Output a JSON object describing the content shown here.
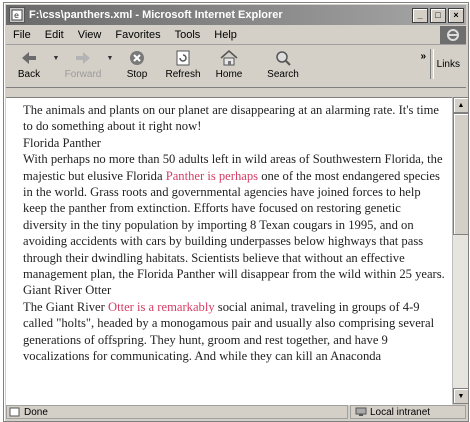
{
  "window": {
    "title": "F:\\css\\panthers.xml - Microsoft Internet Explorer"
  },
  "menu": [
    {
      "label": "File"
    },
    {
      "label": "Edit"
    },
    {
      "label": "View"
    },
    {
      "label": "Favorites"
    },
    {
      "label": "Tools"
    },
    {
      "label": "Help"
    }
  ],
  "toolbar": {
    "back": "Back",
    "forward": "Forward",
    "stop": "Stop",
    "refresh": "Refresh",
    "home": "Home",
    "search": "Search",
    "chevron": "»",
    "links": "Links"
  },
  "content": {
    "intro": "The animals and plants on our planet are disappearing at an alarming rate. It's time to do something about it right now!",
    "panther_title": "Florida Panther",
    "panther_pre": "With perhaps no more than 50 adults left in wild areas of Southwestern Florida, the majestic but elusive Florida ",
    "panther_highlight": "Panther is perhaps",
    "panther_post": " one of the most endangered species in the world. Grass roots and governmental agencies have joined forces to help keep the panther from extinction. Efforts have focused on restoring genetic diversity in the tiny population by importing 8 Texan cougars in 1995, and on avoiding accidents with cars by building underpasses below highways that pass through their dwindling habitats. Scientists believe that without an effective management plan, the Florida Panther will disappear from the wild within 25 years.",
    "otter_title": "Giant River Otter",
    "otter_pre": "The Giant River ",
    "otter_highlight": "Otter is a remarkably",
    "otter_post": " social animal, traveling in groups of 4-9 called \"holts\", headed by a monogamous pair and usually also comprising several generations of offspring. They hunt, groom and rest together, and have 9 vocalizations for communicating. And while they can kill an Anaconda"
  },
  "status": {
    "left": "Done",
    "right": "Local intranet"
  },
  "colors": {
    "highlight": "#d63b63",
    "title_bar": "#7a7a7a"
  }
}
